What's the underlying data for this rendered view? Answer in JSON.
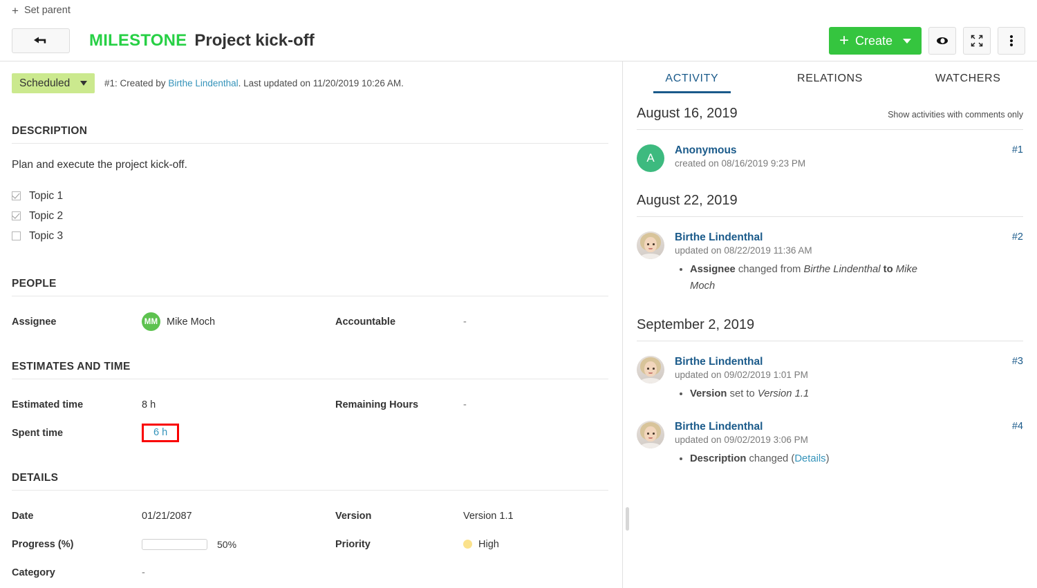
{
  "header": {
    "set_parent_label": "Set parent",
    "back_icon": "arrow-left-icon",
    "type": "MILESTONE",
    "subject": "Project kick-off",
    "create_label": "Create",
    "watch_icon": "eye-icon",
    "fullscreen_icon": "fullscreen-icon",
    "more_icon": "more-vertical-icon",
    "accent_green": "#35c53f",
    "type_green": "#27d045"
  },
  "status": {
    "label": "Scheduled",
    "badge_color": "#cbe98e",
    "meta_prefix": "#1: Created by ",
    "meta_author": "Birthe Lindenthal",
    "meta_suffix": ". Last updated on 11/20/2019 10:26 AM."
  },
  "description": {
    "heading": "DESCRIPTION",
    "text": "Plan and execute the project kick-off.",
    "checklist": [
      {
        "label": "Topic 1",
        "checked": true
      },
      {
        "label": "Topic 2",
        "checked": true
      },
      {
        "label": "Topic 3",
        "checked": false
      }
    ]
  },
  "people": {
    "heading": "PEOPLE",
    "assignee_label": "Assignee",
    "assignee_name": "Mike Moch",
    "assignee_initials": "MM",
    "assignee_avatar_color": "#5dc24f",
    "accountable_label": "Accountable",
    "accountable_value": "-"
  },
  "estimates": {
    "heading": "ESTIMATES AND TIME",
    "estimated_label": "Estimated time",
    "estimated_value": "8 h",
    "remaining_label": "Remaining Hours",
    "remaining_value": "-",
    "spent_label": "Spent time",
    "spent_value": "6 h",
    "highlight_color": "#f90000"
  },
  "details": {
    "heading": "DETAILS",
    "date_label": "Date",
    "date_value": "01/21/2087",
    "version_label": "Version",
    "version_value": "Version 1.1",
    "progress_label": "Progress (%)",
    "progress_value": "50%",
    "progress_percent": 50,
    "priority_label": "Priority",
    "priority_value": "High",
    "priority_color": "#fbe28c",
    "category_label": "Category",
    "category_value": "-"
  },
  "right": {
    "tabs": [
      {
        "label": "ACTIVITY",
        "active": true
      },
      {
        "label": "RELATIONS",
        "active": false
      },
      {
        "label": "WATCHERS",
        "active": false
      }
    ],
    "filter_label": "Show activities with comments only",
    "groups": [
      {
        "date": "August 16, 2019",
        "entries": [
          {
            "avatar_type": "initial",
            "avatar_initial": "A",
            "avatar_color": "#3dba7f",
            "name": "Anonymous",
            "time": "created on 08/16/2019 9:23 PM",
            "number": "#1",
            "changes": []
          }
        ]
      },
      {
        "date": "August 22, 2019",
        "entries": [
          {
            "avatar_type": "photo",
            "name": "Birthe Lindenthal",
            "time": "updated on 08/22/2019 11:36 AM",
            "number": "#2",
            "changes": [
              {
                "field": "Assignee",
                "mid": " changed from ",
                "old": "Birthe Lindenthal",
                "join": " to ",
                "new": "Mike Moch"
              }
            ]
          }
        ]
      },
      {
        "date": "September 2, 2019",
        "entries": [
          {
            "avatar_type": "photo",
            "name": "Birthe Lindenthal",
            "time": "updated on 09/02/2019 1:01 PM",
            "number": "#3",
            "changes": [
              {
                "field": "Version",
                "mid": " set to ",
                "old": "Version 1.1",
                "join": "",
                "new": ""
              }
            ]
          },
          {
            "avatar_type": "photo",
            "name": "Birthe Lindenthal",
            "time": "updated on 09/02/2019 3:06 PM",
            "number": "#4",
            "changes": [
              {
                "field": "Description",
                "mid": " changed (",
                "link": "Details",
                "tail": ")"
              }
            ]
          }
        ]
      }
    ]
  }
}
